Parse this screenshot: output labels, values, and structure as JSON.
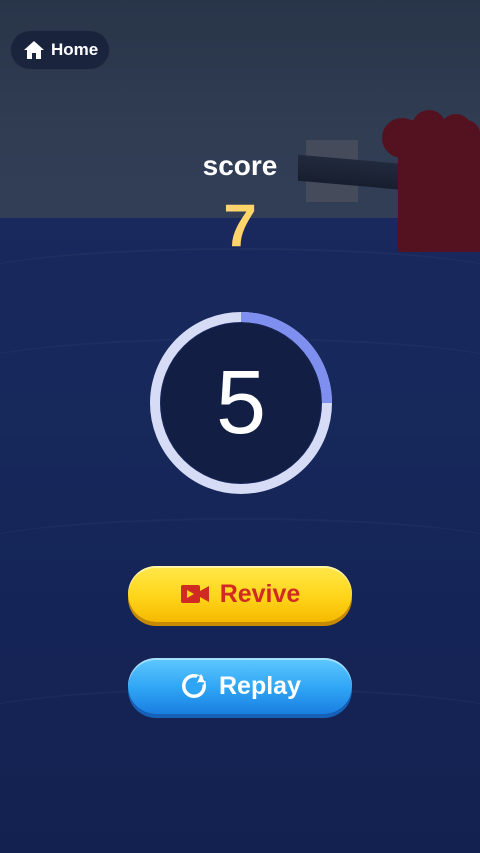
{
  "header": {
    "home_label": "Home"
  },
  "score": {
    "label": "score",
    "value": "7"
  },
  "countdown": {
    "value": "5",
    "progress": 0.25
  },
  "buttons": {
    "revive_label": "Revive",
    "replay_label": "Replay"
  },
  "colors": {
    "score_value": "#ffd46b",
    "revive_bg": "#ffd51a",
    "revive_text": "#cf2b22",
    "replay_bg": "#2ea4f5",
    "ring_track": "#d6dcf5",
    "ring_progress": "#7f8ff0"
  },
  "icons": {
    "home": "home-icon",
    "revive": "video-camera-icon",
    "replay": "replay-icon"
  }
}
